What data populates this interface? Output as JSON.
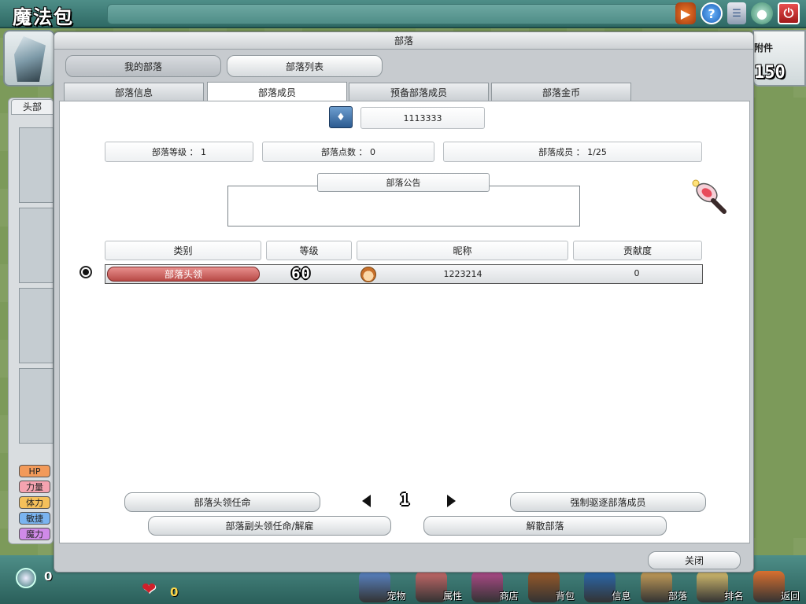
{
  "app": {
    "title": "魔法包"
  },
  "background": {
    "left_tab_label": "头部",
    "right_label": "附件",
    "right_number": "150",
    "stats": [
      {
        "label": "HP",
        "color": "#f29a5a"
      },
      {
        "label": "力量",
        "color": "#f5a3b0"
      },
      {
        "label": "体力",
        "color": "#f5c05a"
      },
      {
        "label": "敏捷",
        "color": "#7ab4f0"
      },
      {
        "label": "魔力",
        "color": "#d08ae8"
      }
    ]
  },
  "bottom": {
    "coins": "0",
    "hearts": "0",
    "menu": [
      {
        "label": "宠物",
        "icon": "pet-icon",
        "color": "#5a86c8"
      },
      {
        "label": "属性",
        "icon": "attribute-icon",
        "color": "#c86a6a"
      },
      {
        "label": "商店",
        "icon": "shop-icon",
        "color": "#b04a8a"
      },
      {
        "label": "背包",
        "icon": "bag-icon",
        "color": "#9a5a28"
      },
      {
        "label": "信息",
        "icon": "info-icon",
        "color": "#2a6ab0"
      },
      {
        "label": "部落",
        "icon": "tribe-icon",
        "color": "#c8a05a"
      },
      {
        "label": "排名",
        "icon": "ranking-icon",
        "color": "#d8c070"
      },
      {
        "label": "返回",
        "icon": "return-icon",
        "color": "#d87030"
      }
    ]
  },
  "dialog": {
    "title": "部落",
    "top_buttons": {
      "my_tribe": "我的部落",
      "tribe_list": "部落列表"
    },
    "tabs": [
      "部落信息",
      "部落成员",
      "预备部落成员",
      "部落金币"
    ],
    "active_tab": "部落成员",
    "tribe_id": "1113333",
    "stats": {
      "level": "部落等级 ： 1",
      "points": "部落点数 ： 0",
      "members": "部落成员 ： 1/25"
    },
    "notice_label": "部落公告",
    "notice_text": "",
    "table": {
      "headers": [
        "类别",
        "等级",
        "昵称",
        "贡献度"
      ],
      "rows": [
        {
          "rank": "部落头领",
          "level": "60",
          "nickname": "1223214",
          "contribution": "0"
        }
      ]
    },
    "page": "1",
    "buttons": {
      "appoint_leader": "部落头领任命",
      "kick_member": "强制驱逐部落成员",
      "deputy_leader": "部落副头领任命/解雇",
      "disband": "解散部落",
      "close": "关闭"
    }
  }
}
